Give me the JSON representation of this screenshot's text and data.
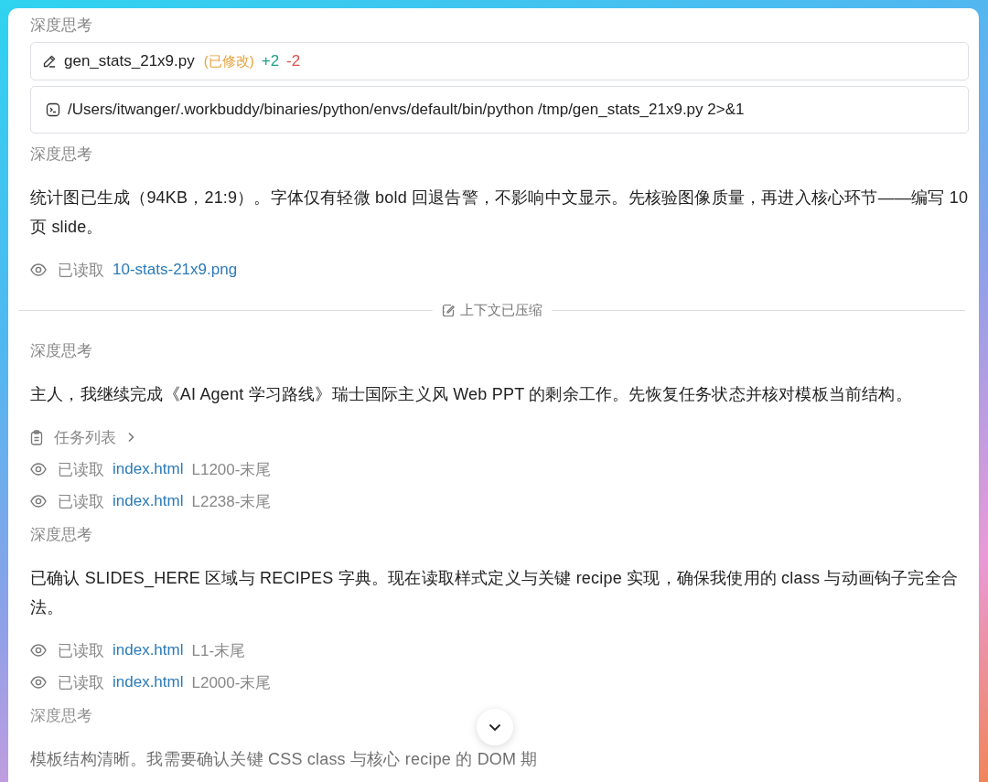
{
  "log": [
    {
      "kind": "thinking",
      "text": "深度思考"
    },
    {
      "kind": "edit",
      "file": "gen_stats_21x9.py",
      "status": "(已修改)",
      "added": "+2",
      "removed": "-2"
    },
    {
      "kind": "command",
      "command": "/Users/itwanger/.workbuddy/binaries/python/envs/default/bin/python /tmp/gen_stats_21x9.py 2>&1"
    },
    {
      "kind": "thinking",
      "text": "深度思考"
    },
    {
      "kind": "paragraph",
      "text": "统计图已生成（94KB，21:9）。字体仅有轻微 bold 回退告警，不影响中文显示。先核验图像质量，再进入核心环节——编写 10 页 slide。"
    },
    {
      "kind": "read",
      "label": "已读取",
      "file": "10-stats-21x9.png"
    },
    {
      "kind": "divider",
      "text": "上下文已压缩"
    },
    {
      "kind": "thinking",
      "text": "深度思考"
    },
    {
      "kind": "paragraph",
      "text": "主人，我继续完成《AI Agent 学习路线》瑞士国际主义风 Web PPT 的剩余工作。先恢复任务状态并核对模板当前结构。"
    },
    {
      "kind": "tasks",
      "label": "任务列表"
    },
    {
      "kind": "read",
      "label": "已读取",
      "file": "index.html",
      "range": "L1200-末尾"
    },
    {
      "kind": "read",
      "label": "已读取",
      "file": "index.html",
      "range": "L2238-末尾"
    },
    {
      "kind": "thinking",
      "text": "深度思考"
    },
    {
      "kind": "paragraph",
      "text": "已确认 SLIDES_HERE 区域与 RECIPES 字典。现在读取样式定义与关键 recipe 实现，确保我使用的 class 与动画钩子完全合法。"
    },
    {
      "kind": "read",
      "label": "已读取",
      "file": "index.html",
      "range": "L1-末尾"
    },
    {
      "kind": "read",
      "label": "已读取",
      "file": "index.html",
      "range": "L2000-末尾"
    },
    {
      "kind": "thinking",
      "text": "深度思考"
    },
    {
      "kind": "paragraph",
      "text": "模板结构清晰。我需要确认关键 CSS class 与核心 recipe 的 DOM 期"
    }
  ]
}
